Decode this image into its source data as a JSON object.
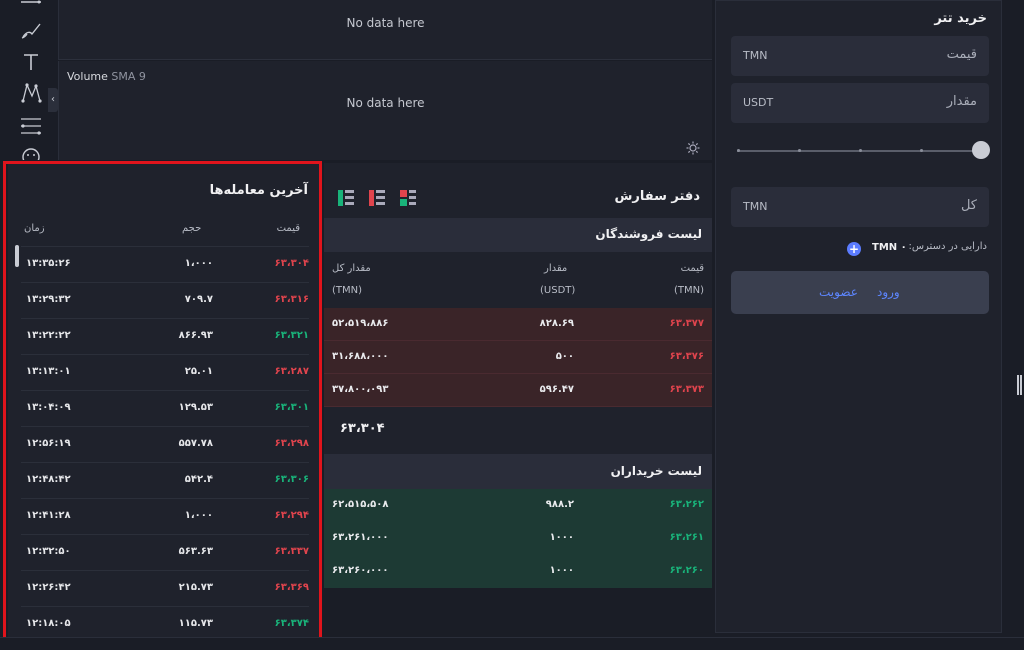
{
  "chart": {
    "pane1_empty": "No data here",
    "pane2_indicator": "Volume",
    "pane2_indicator_param": "SMA 9",
    "pane2_empty": "No data here"
  },
  "toolbar": {
    "tools": [
      "line-tool-icon",
      "brush-icon",
      "text-icon",
      "pattern-icon",
      "fib-icon",
      "emoji-icon"
    ]
  },
  "recent_trades": {
    "title": "آخرین معامله‌ها",
    "headers": {
      "price": "قیمت",
      "volume": "حجم",
      "time": "زمان"
    },
    "rows": [
      {
        "price": "۶۳،۳۰۴",
        "volume": "۱،۰۰۰",
        "time": "۱۳:۳۵:۲۶",
        "side": "sell"
      },
      {
        "price": "۶۳،۳۱۶",
        "volume": "۷۰۹.۷",
        "time": "۱۳:۲۹:۳۲",
        "side": "sell"
      },
      {
        "price": "۶۳،۳۲۱",
        "volume": "۸۶۶.۹۳",
        "time": "۱۳:۲۲:۲۲",
        "side": "buy"
      },
      {
        "price": "۶۳،۲۸۷",
        "volume": "۲۵.۰۱",
        "time": "۱۳:۱۳:۰۱",
        "side": "sell"
      },
      {
        "price": "۶۳،۳۰۱",
        "volume": "۱۲۹.۵۳",
        "time": "۱۳:۰۴:۰۹",
        "side": "buy"
      },
      {
        "price": "۶۳،۲۹۸",
        "volume": "۵۵۷.۷۸",
        "time": "۱۲:۵۶:۱۹",
        "side": "sell"
      },
      {
        "price": "۶۳،۳۰۶",
        "volume": "۵۴۲.۴",
        "time": "۱۲:۴۸:۴۲",
        "side": "buy"
      },
      {
        "price": "۶۳،۲۹۴",
        "volume": "۱،۰۰۰",
        "time": "۱۲:۴۱:۲۸",
        "side": "sell"
      },
      {
        "price": "۶۳،۳۳۷",
        "volume": "۵۶۳.۶۳",
        "time": "۱۲:۳۲:۵۰",
        "side": "sell"
      },
      {
        "price": "۶۳،۳۶۹",
        "volume": "۲۱۵.۷۳",
        "time": "۱۲:۲۶:۴۲",
        "side": "sell"
      },
      {
        "price": "۶۳،۳۷۴",
        "volume": "۱۱۵.۷۳",
        "time": "۱۲:۱۸:۰۵",
        "side": "buy"
      }
    ]
  },
  "order_book": {
    "title": "دفتر سفارش",
    "asks_title": "لیست فروشندگان",
    "bids_title": "لیست خریداران",
    "headers": {
      "price": "قیمت",
      "price_unit": "(TMN)",
      "amount": "مقدار",
      "amount_unit": "(USDT)",
      "total": "مقدار کل",
      "total_unit": "(TMN)"
    },
    "asks": [
      {
        "price": "۶۳،۳۷۷",
        "amount": "۸۲۸.۶۹",
        "total": "۵۲،۵۱۹،۸۸۶"
      },
      {
        "price": "۶۳،۳۷۶",
        "amount": "۵۰۰",
        "total": "۳۱،۶۸۸،۰۰۰"
      },
      {
        "price": "۶۳،۳۷۳",
        "amount": "۵۹۶.۴۷",
        "total": "۳۷،۸۰۰،۰۹۳"
      }
    ],
    "last_price": "۶۳،۳۰۴",
    "bids": [
      {
        "price": "۶۳،۲۶۲",
        "amount": "۹۸۸.۲",
        "total": "۶۲،۵۱۵،۵۰۸"
      },
      {
        "price": "۶۳،۲۶۱",
        "amount": "۱۰۰۰",
        "total": "۶۳،۲۶۱،۰۰۰"
      },
      {
        "price": "۶۳،۲۶۰",
        "amount": "۱۰۰۰",
        "total": "۶۳،۲۶۰،۰۰۰"
      }
    ]
  },
  "buy_panel": {
    "title": "خرید تتر",
    "price_label": "قیمت",
    "price_unit": "TMN",
    "amount_label": "مقدار",
    "amount_unit": "USDT",
    "total_label": "کل",
    "total_unit": "TMN",
    "available_label": "دارایی در دسترس:",
    "available_value": "TMN ۰",
    "login": "ورود",
    "register": "عضویت",
    "slider_fraction": 1.0
  },
  "colors": {
    "sell": "#e0444d",
    "buy": "#19b37a",
    "accent": "#5d86ff"
  }
}
